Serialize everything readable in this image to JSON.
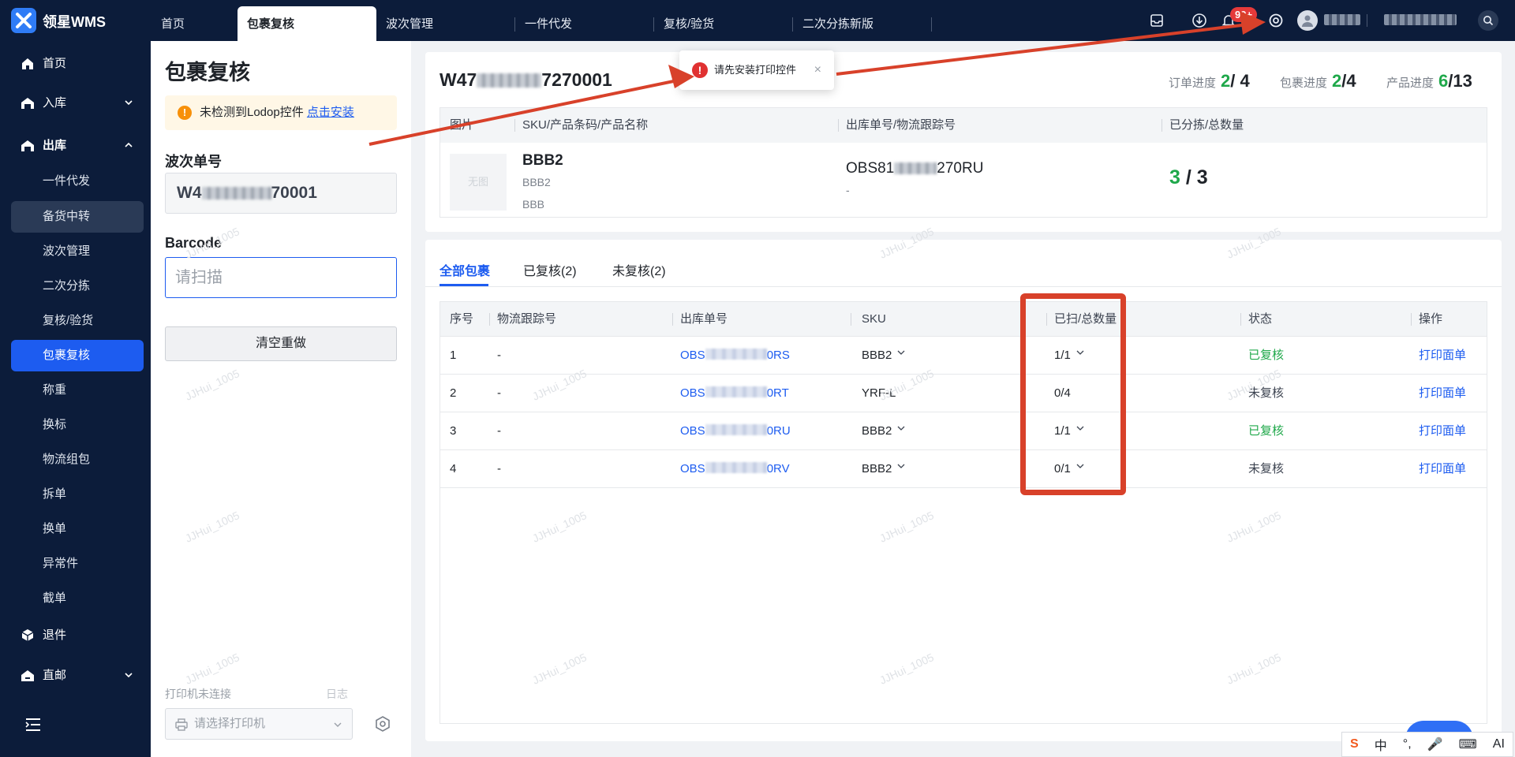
{
  "app": {
    "name": "领星WMS"
  },
  "top_tabs": [
    {
      "label": "首页",
      "active": false
    },
    {
      "label": "包裹复核",
      "active": true
    },
    {
      "label": "波次管理",
      "active": false
    },
    {
      "label": "一件代发",
      "active": false
    },
    {
      "label": "复核/验货",
      "active": false
    },
    {
      "label": "二次分拣新版",
      "active": false
    }
  ],
  "top_icons": [
    "inbox-icon",
    "download-icon",
    "bell-icon",
    "settings-icon",
    "avatar",
    "search-icon"
  ],
  "notification_badge": "99+",
  "sidebar": {
    "items": [
      {
        "label": "首页",
        "icon": "home-icon"
      },
      {
        "label": "入库",
        "icon": "inbound-icon"
      },
      {
        "label": "出库",
        "icon": "outbound-icon"
      },
      {
        "label": "退件",
        "icon": "return-icon"
      },
      {
        "label": "直邮",
        "icon": "direct-mail-icon"
      }
    ],
    "sub_items": [
      {
        "label": "一件代发"
      },
      {
        "label": "备货中转"
      },
      {
        "label": "波次管理"
      },
      {
        "label": "二次分拣"
      },
      {
        "label": "复核/验货"
      },
      {
        "label": "包裹复核"
      },
      {
        "label": "称重"
      },
      {
        "label": "换标"
      },
      {
        "label": "物流组包"
      },
      {
        "label": "拆单"
      },
      {
        "label": "换单"
      },
      {
        "label": "异常件"
      },
      {
        "label": "截单"
      }
    ],
    "active_sub": "包裹复核"
  },
  "left_panel": {
    "title": "包裹复核",
    "alert_text": "未检测到Lodop控件",
    "alert_link": "点击安装",
    "wave_label": "波次单号",
    "wave_prefix": "W4",
    "wave_suffix": "70001",
    "barcode_label": "Barcode",
    "barcode_placeholder": "请扫描",
    "clear_button": "清空重做",
    "printer_status": "打印机未连接",
    "log_link": "日志",
    "printer_placeholder": "请选择打印机"
  },
  "summary": {
    "wave_prefix": "W47",
    "wave_suffix": "7270001",
    "progress": [
      {
        "label": "订单进度",
        "done": "2",
        "total": "/ 4"
      },
      {
        "label": "包裹进度",
        "done": "2",
        "total": "/4"
      },
      {
        "label": "产品进度",
        "done": "6",
        "total": "/13"
      }
    ],
    "columns": [
      "图片",
      "SKU/产品条码/产品名称",
      "出库单号/物流跟踪号",
      "已分拣/总数量"
    ],
    "product": {
      "image_placeholder": "无图",
      "name": "BBB2",
      "barcode": "BBB2",
      "sub_name": "BBB",
      "order_prefix": "OBS81",
      "order_suffix": "270RU",
      "tracking": "-",
      "sorted": "3",
      "total": "/ 3"
    }
  },
  "toast": {
    "message": "请先安装打印控件"
  },
  "package_tabs": [
    {
      "label": "全部包裹",
      "active": true
    },
    {
      "label": "已复核(2)",
      "active": false
    },
    {
      "label": "未复核(2)",
      "active": false
    }
  ],
  "package_table": {
    "columns": [
      "序号",
      "物流跟踪号",
      "出库单号",
      "SKU",
      "已扫/总数量",
      "状态",
      "操作"
    ],
    "rows": [
      {
        "no": "1",
        "tracking": "-",
        "order_prefix": "OBS",
        "order_suffix": "0RS",
        "sku": "BBB2",
        "sku_dropdown": true,
        "scanned": "1/1",
        "qty_dropdown": true,
        "status": "已复核",
        "reviewed": true,
        "action": "打印面单"
      },
      {
        "no": "2",
        "tracking": "-",
        "order_prefix": "OBS",
        "order_suffix": "0RT",
        "sku": "YRF-L",
        "sku_dropdown": false,
        "scanned": "0/4",
        "qty_dropdown": false,
        "status": "未复核",
        "reviewed": false,
        "action": "打印面单"
      },
      {
        "no": "3",
        "tracking": "-",
        "order_prefix": "OBS",
        "order_suffix": "0RU",
        "sku": "BBB2",
        "sku_dropdown": true,
        "scanned": "1/1",
        "qty_dropdown": true,
        "status": "已复核",
        "reviewed": true,
        "action": "打印面单"
      },
      {
        "no": "4",
        "tracking": "-",
        "order_prefix": "OBS",
        "order_suffix": "0RV",
        "sku": "BBB2",
        "sku_dropdown": true,
        "scanned": "0/1",
        "qty_dropdown": true,
        "status": "未复核",
        "reviewed": false,
        "action": "打印面单"
      }
    ]
  },
  "watermark": "JJHui_1005",
  "ime_bar": [
    "中",
    "°,",
    "🎤",
    "⌨",
    "AI"
  ],
  "colors": {
    "accent": "#1d5cf0",
    "nav": "#0c1c3a",
    "success": "#1fa84a",
    "annotation": "#d8412a"
  }
}
